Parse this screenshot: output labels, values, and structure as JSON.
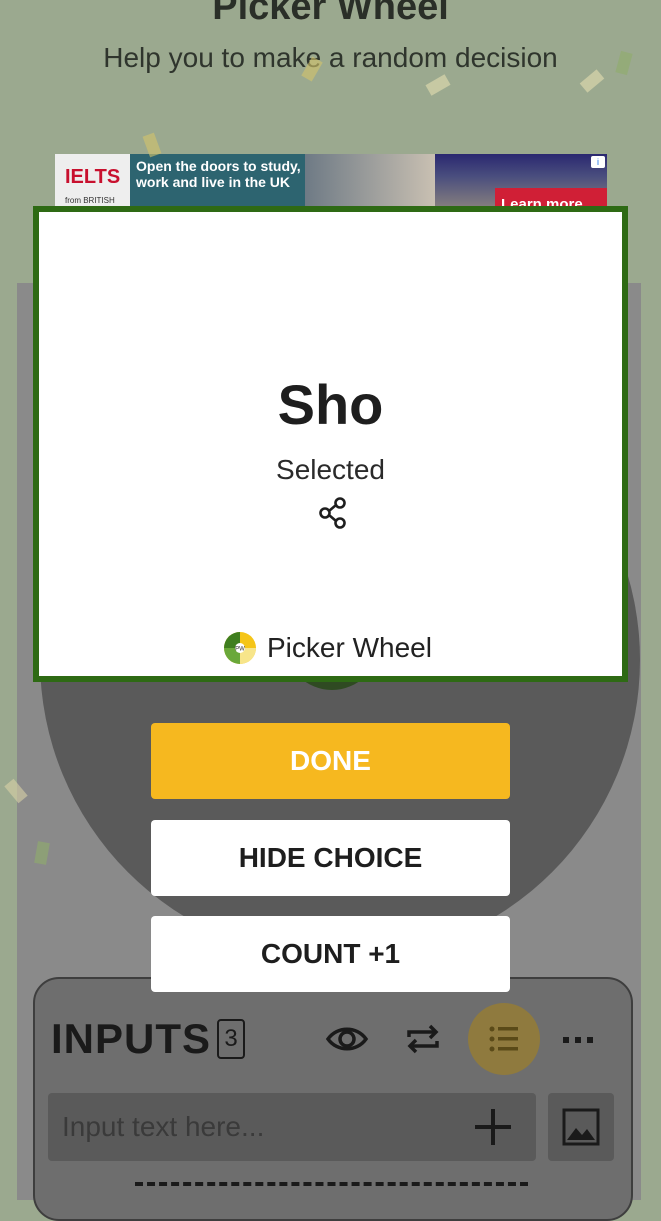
{
  "header": {
    "title": "Picker Wheel",
    "subtitle": "Help you to make a random decision"
  },
  "ad": {
    "logo": "IELTS",
    "from": "from BRITISH COUNCIL",
    "text": "Open the doors to study, work and live in the UK",
    "cta": "Learn more",
    "info": "i"
  },
  "result": {
    "name": "Sho",
    "status": "Selected",
    "brand": "Picker Wheel"
  },
  "buttons": {
    "done": "DONE",
    "hide_choice": "HIDE CHOICE",
    "count": "COUNT +1"
  },
  "inputs": {
    "title": "INPUTS",
    "count": "3",
    "placeholder": "Input text here..."
  },
  "colors": {
    "modal_border": "#2e6a14",
    "done_button": "#f6b81f",
    "brand_yellow": "#f5c518",
    "brand_green": "#3f7e1f"
  },
  "icons": [
    "share-icon",
    "eye-icon",
    "shuffle-icon",
    "list-icon",
    "more-icon",
    "plus-icon",
    "image-icon",
    "picker-wheel-logo"
  ]
}
